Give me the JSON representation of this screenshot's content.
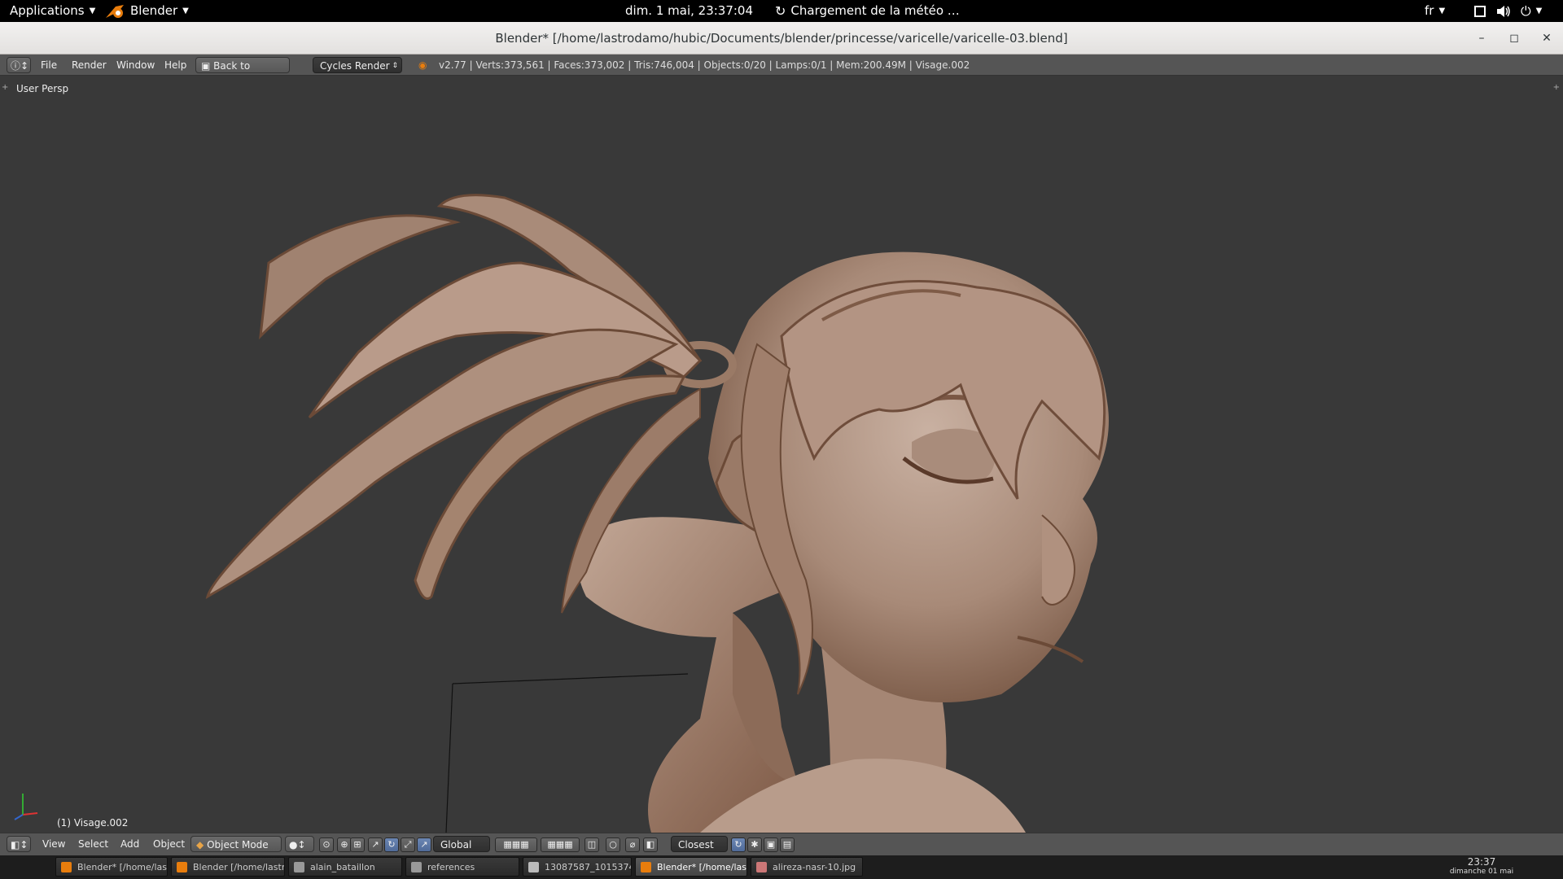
{
  "topbar": {
    "applications": "Applications",
    "app": "Blender",
    "datetime": "dim.  1 mai, 23:37:04",
    "weather": "Chargement de la météo …",
    "lang": "fr"
  },
  "window": {
    "title": "Blender* [/home/lastrodamo/hubic/Documents/blender/princesse/varicelle/varicelle-03.blend]",
    "minimize": "–",
    "maximize": "◻",
    "close": "✕"
  },
  "info_header": {
    "menus": [
      "File",
      "Render",
      "Window",
      "Help"
    ],
    "back_button": "Back to Previous",
    "engine": "Cycles Render",
    "stats": "v2.77 | Verts:373,561 | Faces:373,002 | Tris:746,004 | Objects:0/20 | Lamps:0/1 | Mem:200.49M | Visage.002"
  },
  "viewport": {
    "view_name": "User Persp",
    "object_label": "(1) Visage.002"
  },
  "view3d_header": {
    "menus": [
      "View",
      "Select",
      "Add",
      "Object"
    ],
    "mode": "Object Mode",
    "orientation": "Global",
    "snap_target": "Closest"
  },
  "taskbar": {
    "tasks": [
      "Blender* [/home/las...",
      "Blender [/home/lastr...",
      "alain_bataillon",
      "references",
      "13087587_1015374...",
      "Blender* [/home/las...",
      "alireza-nasr-10.jpg"
    ],
    "clock_time": "23:37",
    "clock_date": "dimanche 01 mai"
  },
  "colors": {
    "accent": "#e87d0d",
    "clay": "#b69683",
    "viewport_bg": "#393939"
  }
}
